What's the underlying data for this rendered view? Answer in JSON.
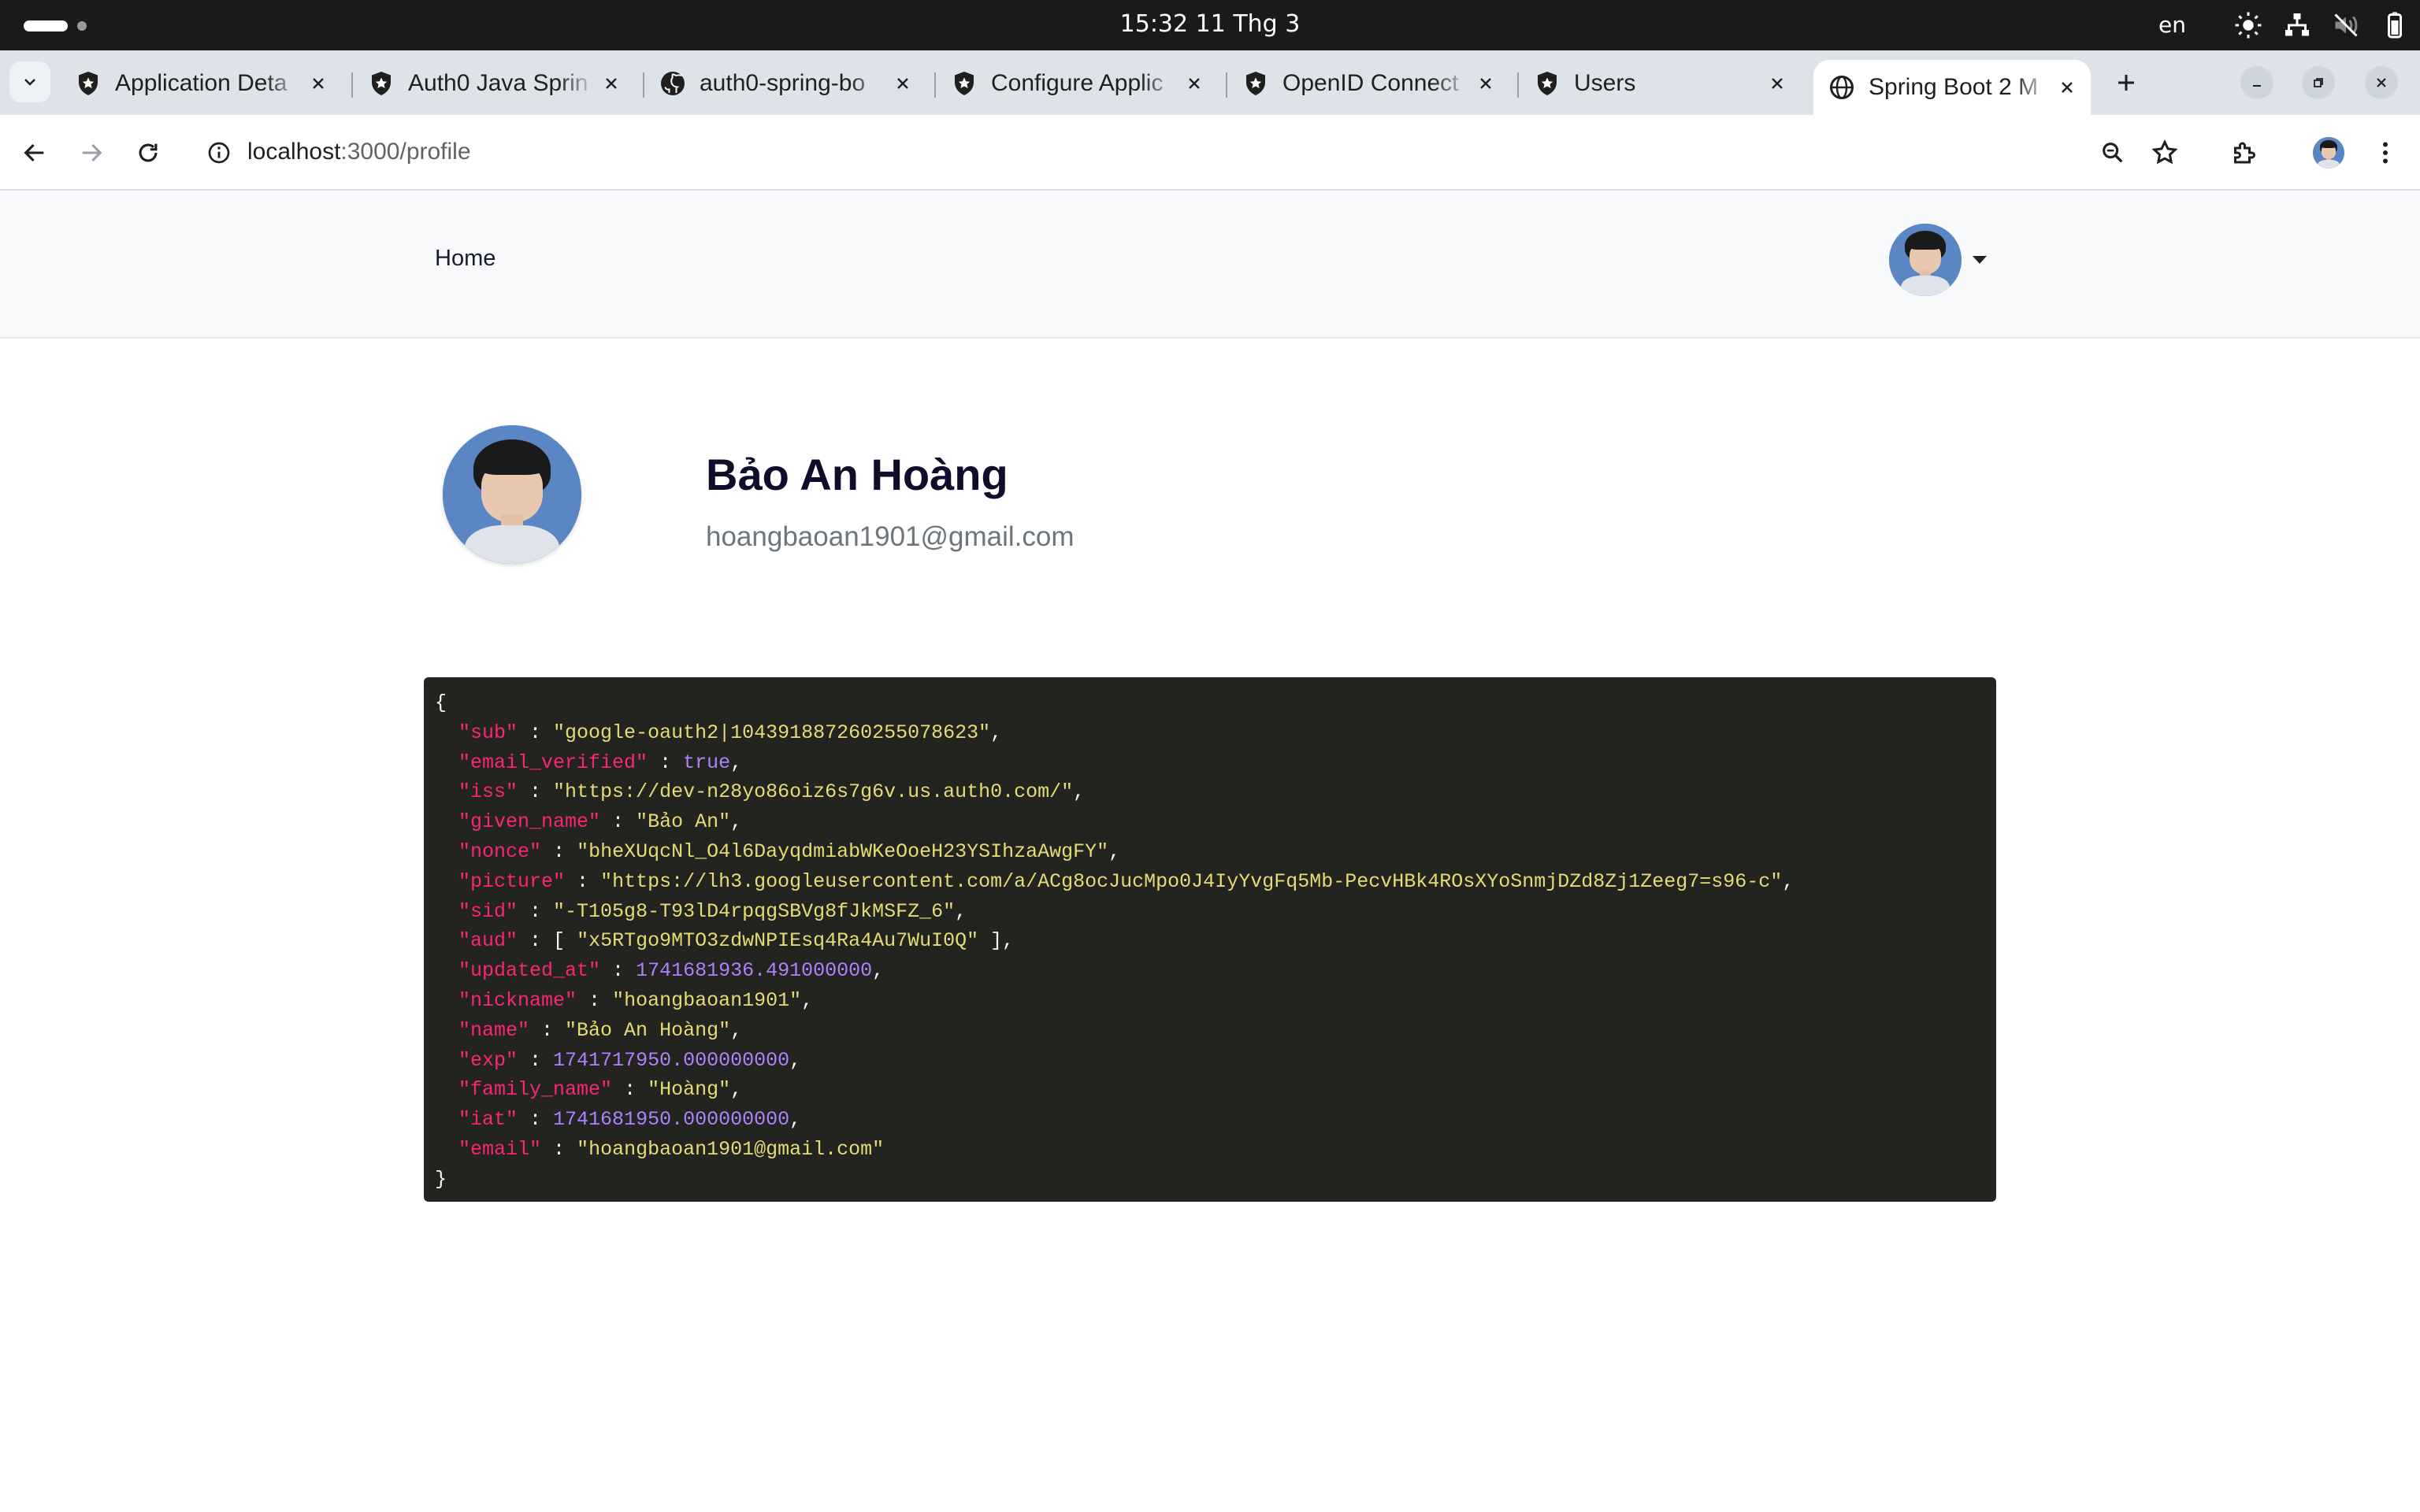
{
  "system_bar": {
    "clock": "15:32  11 Thg 3",
    "language": "en"
  },
  "tabs": [
    {
      "label": "Application Deta",
      "icon": "auth0-shield-icon",
      "active": false
    },
    {
      "label": "Auth0 Java Sprin",
      "icon": "auth0-shield-icon",
      "active": false
    },
    {
      "label": "auth0-spring-bo",
      "icon": "github-icon",
      "active": false
    },
    {
      "label": "Configure Applic",
      "icon": "auth0-shield-icon",
      "active": false
    },
    {
      "label": "OpenID Connect",
      "icon": "auth0-shield-icon",
      "active": false
    },
    {
      "label": "Users",
      "icon": "auth0-shield-icon",
      "active": false
    },
    {
      "label": "Spring Boot 2 M",
      "icon": "globe-icon",
      "active": true
    }
  ],
  "address_bar": {
    "host": "localhost",
    "path": ":3000/profile"
  },
  "site_nav": {
    "home_label": "Home"
  },
  "profile": {
    "name": "Bảo An Hoàng",
    "email": "hoangbaoan1901@gmail.com"
  },
  "claims": [
    {
      "key": "\"sub\"",
      "value": "\"google-oauth2|104391887260255078623\"",
      "kind": "string"
    },
    {
      "key": "\"email_verified\"",
      "value": "true",
      "kind": "number"
    },
    {
      "key": "\"iss\"",
      "value": "\"https://dev-n28yo86oiz6s7g6v.us.auth0.com/\"",
      "kind": "string"
    },
    {
      "key": "\"given_name\"",
      "value": "\"Bảo An\"",
      "kind": "string"
    },
    {
      "key": "\"nonce\"",
      "value": "\"bheXUqcNl_O4l6DayqdmiabWKeOoeH23YSIhzaAwgFY\"",
      "kind": "string"
    },
    {
      "key": "\"picture\"",
      "value": "\"https://lh3.googleusercontent.com/a/ACg8ocJucMpo0J4IyYvgFq5Mb-PecvHBk4ROsXYoSnmjDZd8Zj1Zeeg7=s96-c\"",
      "kind": "string"
    },
    {
      "key": "\"sid\"",
      "value": "\"-T105g8-T93lD4rpqgSBVg8fJkMSFZ_6\"",
      "kind": "string"
    },
    {
      "key": "\"aud\"",
      "value": "\"x5RTgo9MTO3zdwNPIEsq4Ra4Au7WuI0Q\"",
      "kind": "array"
    },
    {
      "key": "\"updated_at\"",
      "value": "1741681936.491000000",
      "kind": "number"
    },
    {
      "key": "\"nickname\"",
      "value": "\"hoangbaoan1901\"",
      "kind": "string"
    },
    {
      "key": "\"name\"",
      "value": "\"Bảo An Hoàng\"",
      "kind": "string"
    },
    {
      "key": "\"exp\"",
      "value": "1741717950.000000000",
      "kind": "number"
    },
    {
      "key": "\"family_name\"",
      "value": "\"Hoàng\"",
      "kind": "string"
    },
    {
      "key": "\"iat\"",
      "value": "1741681950.000000000",
      "kind": "number"
    },
    {
      "key": "\"email\"",
      "value": "\"hoangbaoan1901@gmail.com\"",
      "kind": "string"
    }
  ],
  "colors": {
    "code_bg": "#23241f",
    "json_key": "#f92672",
    "json_string": "#e6db74",
    "json_number": "#ae81ff",
    "navbar_bg": "#f8f9fa",
    "name_text": "#0e0e2c"
  }
}
